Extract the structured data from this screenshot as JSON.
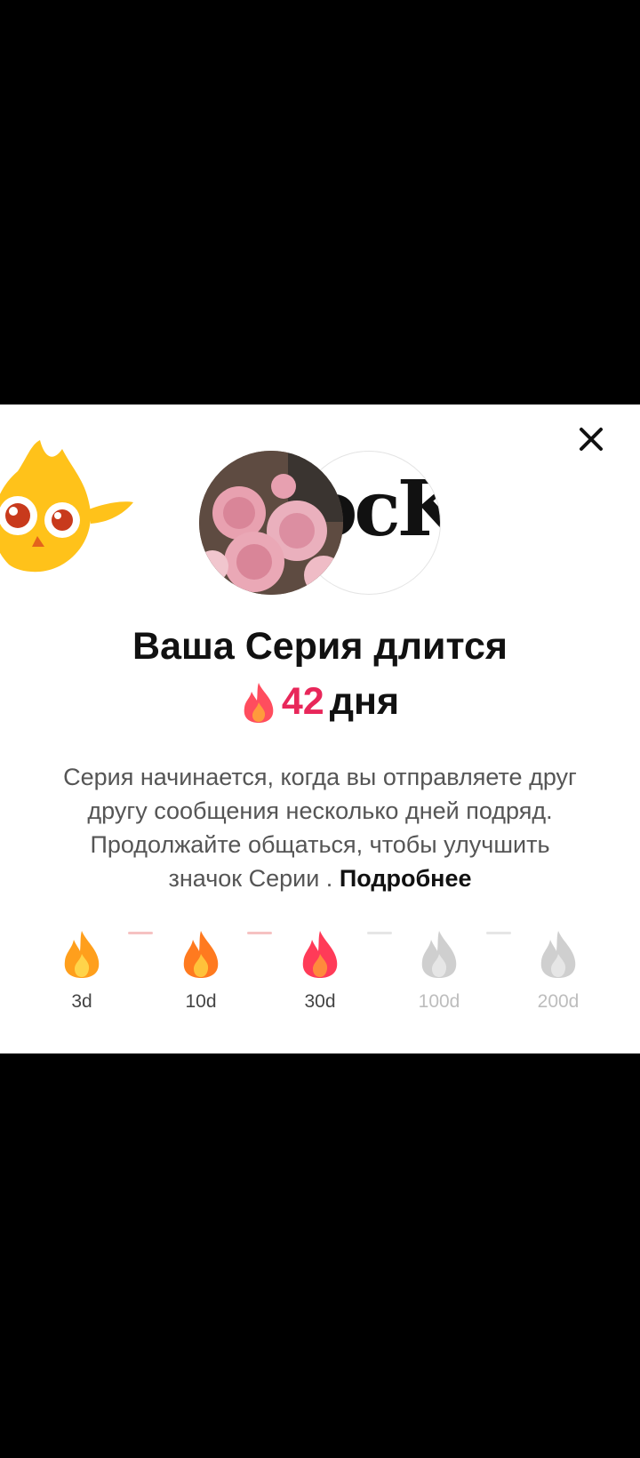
{
  "dialog": {
    "title": "Ваша Серия длится",
    "streak_count": "42",
    "streak_unit": "дня",
    "description": "Серия начинается, когда вы отправляете друг другу сообщения несколько дней подряд. Продолжайте общаться, чтобы улучшить значок Серии . ",
    "more_link": "Подробнее",
    "avatar_text": "ocK",
    "close_icon": "close-icon"
  },
  "milestones": [
    {
      "label": "3d",
      "active": true
    },
    {
      "label": "10d",
      "active": true
    },
    {
      "label": "30d",
      "active": true
    },
    {
      "label": "100d",
      "active": false
    },
    {
      "label": "200d",
      "active": false
    }
  ],
  "colors": {
    "accent": "#e8275a",
    "fire_orange": "#ff8a1f",
    "fire_red": "#ff3b58",
    "inactive": "#c9c9c9"
  }
}
